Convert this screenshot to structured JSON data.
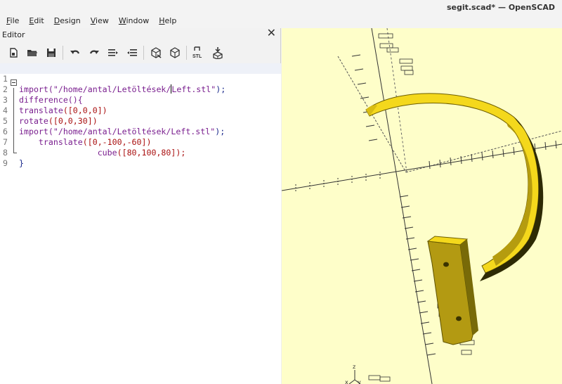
{
  "window": {
    "title": "segit.scad* — OpenSCAD"
  },
  "menu": [
    {
      "mnemonic": "F",
      "rest": "ile"
    },
    {
      "mnemonic": "E",
      "rest": "dit"
    },
    {
      "mnemonic": "D",
      "rest": "esign"
    },
    {
      "mnemonic": "V",
      "rest": "iew"
    },
    {
      "mnemonic": "W",
      "rest": "indow"
    },
    {
      "mnemonic": "H",
      "rest": "elp"
    }
  ],
  "editor": {
    "label": "Editor",
    "close_glyph": "✕",
    "line_numbers": [
      "1",
      "2",
      "3",
      "4",
      "5",
      "6",
      "7",
      "8",
      "9"
    ],
    "toolbar_icons": [
      "new-file-icon",
      "open-file-icon",
      "save-icon",
      "undo-icon",
      "redo-icon",
      "unindent-icon",
      "indent-icon",
      "preview-icon",
      "render-icon",
      "export-stl-icon",
      "send-to-printer-icon"
    ],
    "stl_label": "STL",
    "code": {
      "l1_fn": "import",
      "l1_str_a": "(\"/home/antal/Letöltések/",
      "l1_str_b": "Left.stl\"",
      "l1_end": ");",
      "l2": "difference(){",
      "l3_fn": "translate",
      "l3_args": "([0,0,0])",
      "l4_fn": "rotate",
      "l4_args": "([0,0,30])",
      "l5_fn": "import",
      "l5_str": "(\"/home/antal/Letöltések/Left.stl\"",
      "l5_end": ");",
      "l6_indent": "    ",
      "l6_fn": "translate",
      "l6_args": "([0,-100,-60])",
      "l7_indent": "                ",
      "l7_fn": "cube",
      "l7_args": "([80,100,80]);",
      "l8": "}"
    }
  },
  "viewport": {
    "background": "#fefec9",
    "model_color": "#f4d81c",
    "axis_labels": {
      "x": "x",
      "y": "y",
      "z": "z"
    }
  }
}
